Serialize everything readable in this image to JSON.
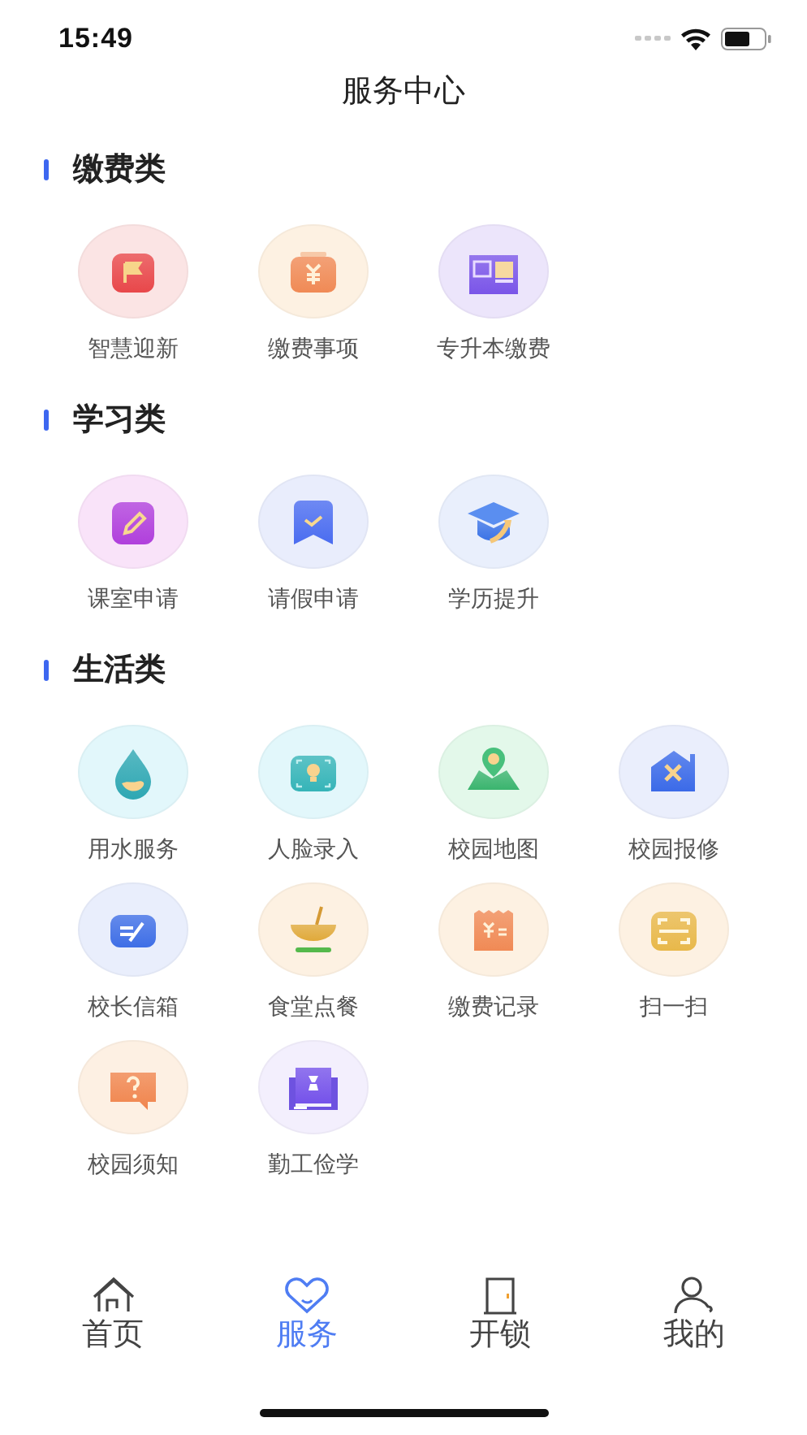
{
  "status_bar": {
    "time": "15:49"
  },
  "header": {
    "title": "服务中心"
  },
  "sections": [
    {
      "title": "缴费类",
      "items": [
        {
          "label": "智慧迎新"
        },
        {
          "label": "缴费事项"
        },
        {
          "label": "专升本缴费"
        }
      ]
    },
    {
      "title": "学习类",
      "items": [
        {
          "label": "课室申请"
        },
        {
          "label": "请假申请"
        },
        {
          "label": "学历提升"
        }
      ]
    },
    {
      "title": "生活类",
      "items": [
        {
          "label": "用水服务"
        },
        {
          "label": "人脸录入"
        },
        {
          "label": "校园地图"
        },
        {
          "label": "校园报修"
        },
        {
          "label": "校长信箱"
        },
        {
          "label": "食堂点餐"
        },
        {
          "label": "缴费记录"
        },
        {
          "label": "扫一扫"
        },
        {
          "label": "校园须知"
        },
        {
          "label": "勤工俭学"
        }
      ]
    }
  ],
  "tab_bar": [
    {
      "label": "首页",
      "selected": false
    },
    {
      "label": "服务",
      "selected": true
    },
    {
      "label": "开锁",
      "selected": false
    },
    {
      "label": "我的",
      "selected": false
    }
  ]
}
